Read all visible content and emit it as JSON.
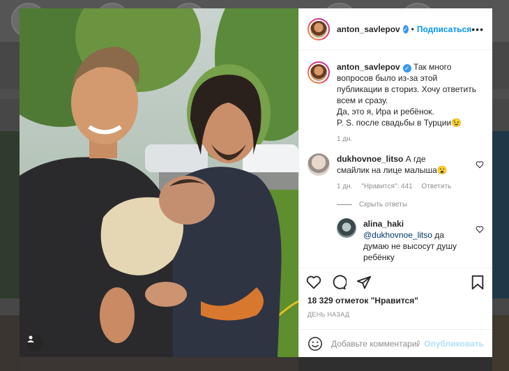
{
  "post": {
    "author": "anton_savlepov",
    "follow_label": "Подписаться",
    "more_icon": "more-horizontal-icon",
    "caption_lines": [
      "Так много",
      "вопросов было из-за этой",
      "публикации в сториз. Хочу ответить",
      "всем и сразу.",
      "Да, это я, Ира и ребёнок.",
      "P. S. после свадьбы в Турции😉"
    ],
    "caption_time": "1 дн."
  },
  "comments": [
    {
      "user": "dukhovnoe_litso",
      "text_line1": "А где",
      "text_line2": "смайлик на лице малыша😮",
      "time": "1 дн.",
      "likes_label": "\"Нравится\": 441",
      "reply_label": "Ответить",
      "hide_replies": "Скрыть ответы"
    },
    {
      "user": "alina_haki",
      "mention": "@dukhovnoe_litso",
      "text_tail": "да",
      "text_line2": "думаю не высосут душу",
      "text_line3": "ребёнку"
    }
  ],
  "footer": {
    "likes": "18 329 отметок \"Нравится\"",
    "posted_ago": "ДЕНЬ НАЗАД",
    "comment_placeholder": "Добавьте комментарий...",
    "post_label": "Опубликовать"
  },
  "colors": {
    "accent": "#0095f6",
    "verified": "#3897f0",
    "post_disabled": "#b2dffc"
  }
}
